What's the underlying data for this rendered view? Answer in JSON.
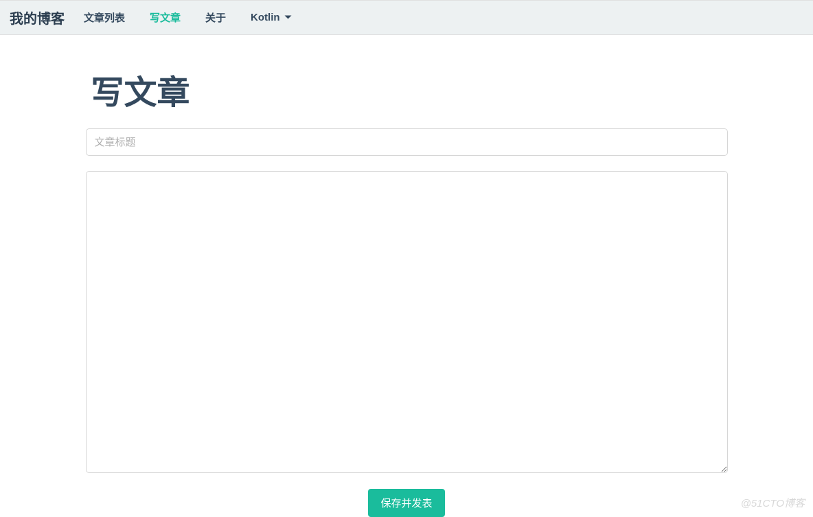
{
  "navbar": {
    "brand": "我的博客",
    "items": [
      {
        "label": "文章列表",
        "active": false
      },
      {
        "label": "写文章",
        "active": true
      },
      {
        "label": "关于",
        "active": false
      },
      {
        "label": "Kotlin",
        "active": false,
        "dropdown": true
      }
    ]
  },
  "page": {
    "title": "写文章"
  },
  "form": {
    "title_placeholder": "文章标题",
    "title_value": "",
    "content_value": "",
    "publish_label": "保存并发表"
  },
  "watermark": "@51CTO博客"
}
